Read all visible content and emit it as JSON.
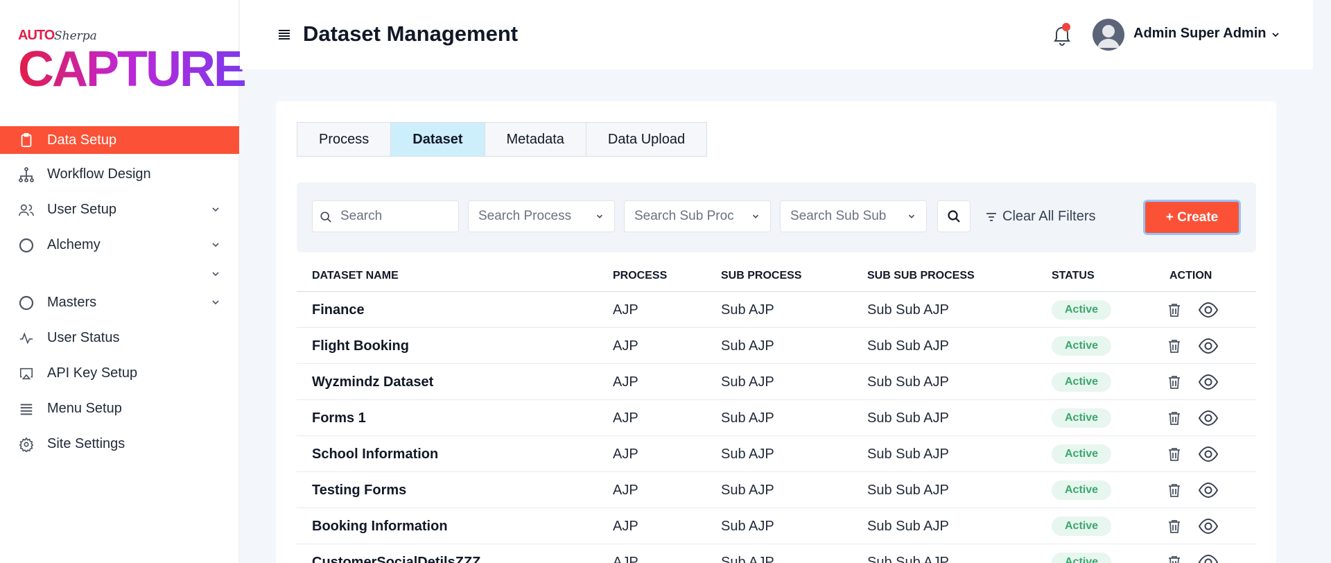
{
  "brand": {
    "auto": "AUTO",
    "sherpa": "Sherpa",
    "capture": "CAPTURE"
  },
  "sidebar": {
    "items": [
      {
        "label": "Data Setup",
        "icon": "clipboard-icon",
        "active": true
      },
      {
        "label": "Workflow Design",
        "icon": "hierarchy-icon"
      },
      {
        "label": "User Setup",
        "icon": "users-icon",
        "expandable": true
      },
      {
        "label": "Alchemy",
        "icon": "circle-icon",
        "expandable": true
      },
      {
        "label": "Masters",
        "icon": "circle-icon",
        "expandable": true
      },
      {
        "label": "User Status",
        "icon": "activity-icon"
      },
      {
        "label": "API Key Setup",
        "icon": "airplay-icon"
      },
      {
        "label": "Menu Setup",
        "icon": "list-icon"
      },
      {
        "label": "Site Settings",
        "icon": "gear-icon"
      }
    ]
  },
  "header": {
    "title": "Dataset Management",
    "user_name": "Admin Super Admin"
  },
  "tabs": [
    {
      "label": "Process"
    },
    {
      "label": "Dataset",
      "active": true
    },
    {
      "label": "Metadata"
    },
    {
      "label": "Data Upload"
    }
  ],
  "filters": {
    "search_placeholder": "Search",
    "process_placeholder": "Search Process",
    "sub_process_placeholder": "Search Sub Proc",
    "sub_sub_process_placeholder": "Search Sub Sub",
    "clear_label": "Clear All Filters",
    "create_label": "+ Create"
  },
  "table": {
    "columns": [
      "DATASET NAME",
      "PROCESS",
      "SUB PROCESS",
      "SUB SUB PROCESS",
      "STATUS",
      "ACTION"
    ],
    "rows": [
      {
        "name": "Finance",
        "process": "AJP",
        "sub_process": "Sub AJP",
        "sub_sub_process": "Sub Sub AJP",
        "status": "Active"
      },
      {
        "name": "Flight Booking",
        "process": "AJP",
        "sub_process": "Sub AJP",
        "sub_sub_process": "Sub Sub AJP",
        "status": "Active"
      },
      {
        "name": "Wyzmindz Dataset",
        "process": "AJP",
        "sub_process": "Sub AJP",
        "sub_sub_process": "Sub Sub AJP",
        "status": "Active"
      },
      {
        "name": "Forms 1",
        "process": "AJP",
        "sub_process": "Sub AJP",
        "sub_sub_process": "Sub Sub AJP",
        "status": "Active"
      },
      {
        "name": "School Information",
        "process": "AJP",
        "sub_process": "Sub AJP",
        "sub_sub_process": "Sub Sub AJP",
        "status": "Active"
      },
      {
        "name": "Testing Forms",
        "process": "AJP",
        "sub_process": "Sub AJP",
        "sub_sub_process": "Sub Sub AJP",
        "status": "Active"
      },
      {
        "name": "Booking Information",
        "process": "AJP",
        "sub_process": "Sub AJP",
        "sub_sub_process": "Sub Sub AJP",
        "status": "Active"
      },
      {
        "name": "CustomerSocialDetilsZZZ",
        "process": "AJP",
        "sub_process": "Sub AJP",
        "sub_sub_process": "Sub Sub AJP",
        "status": "Active"
      }
    ]
  },
  "colors": {
    "accent": "#fb5237",
    "active_tab": "#cdeefb",
    "status_active": "#3aa76d",
    "status_bg": "#e7f6ee"
  }
}
